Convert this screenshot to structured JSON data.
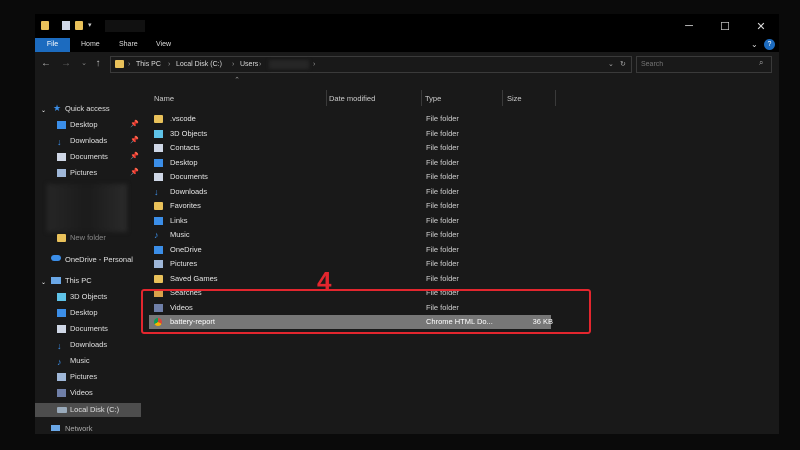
{
  "ribbon": {
    "tabs": [
      "File",
      "Home",
      "Share",
      "View"
    ]
  },
  "address": {
    "crumbs": [
      "This PC",
      "Local Disk (C:)",
      "Users"
    ]
  },
  "search": {
    "placeholder": "Search"
  },
  "columns": {
    "name": "Name",
    "date": "Date modified",
    "type": "Type",
    "size": "Size"
  },
  "nav": {
    "quick_access": "Quick access",
    "quick_items": [
      "Desktop",
      "Downloads",
      "Documents",
      "Pictures"
    ],
    "new_folder": "New folder",
    "onedrive": "OneDrive - Personal",
    "this_pc": "This PC",
    "pc_items": [
      "3D Objects",
      "Desktop",
      "Documents",
      "Downloads",
      "Music",
      "Pictures",
      "Videos",
      "Local Disk (C:)"
    ],
    "network": "Network"
  },
  "files": [
    {
      "name": ".vscode",
      "type": "File folder",
      "size": "",
      "icon": "folder-icon"
    },
    {
      "name": "3D Objects",
      "type": "File folder",
      "size": "",
      "icon": "3d-objects-icon"
    },
    {
      "name": "Contacts",
      "type": "File folder",
      "size": "",
      "icon": "contacts-icon"
    },
    {
      "name": "Desktop",
      "type": "File folder",
      "size": "",
      "icon": "desktop-icon"
    },
    {
      "name": "Documents",
      "type": "File folder",
      "size": "",
      "icon": "documents-icon"
    },
    {
      "name": "Downloads",
      "type": "File folder",
      "size": "",
      "icon": "downloads-icon"
    },
    {
      "name": "Favorites",
      "type": "File folder",
      "size": "",
      "icon": "favorites-icon"
    },
    {
      "name": "Links",
      "type": "File folder",
      "size": "",
      "icon": "links-icon"
    },
    {
      "name": "Music",
      "type": "File folder",
      "size": "",
      "icon": "music-icon"
    },
    {
      "name": "OneDrive",
      "type": "File folder",
      "size": "",
      "icon": "onedrive-icon"
    },
    {
      "name": "Pictures",
      "type": "File folder",
      "size": "",
      "icon": "pictures-icon"
    },
    {
      "name": "Saved Games",
      "type": "File folder",
      "size": "",
      "icon": "saved-games-icon"
    },
    {
      "name": "Searches",
      "type": "File folder",
      "size": "",
      "icon": "searches-icon"
    },
    {
      "name": "Videos",
      "type": "File folder",
      "size": "",
      "icon": "videos-icon"
    },
    {
      "name": "battery-report",
      "type": "Chrome HTML Do...",
      "size": "36 KB",
      "icon": "chrome-html-icon"
    }
  ],
  "annotation": {
    "step": "4"
  },
  "colors": {
    "accent": "#1c6bbf",
    "highlight": "#e3262e",
    "selected_row": "#777777"
  }
}
